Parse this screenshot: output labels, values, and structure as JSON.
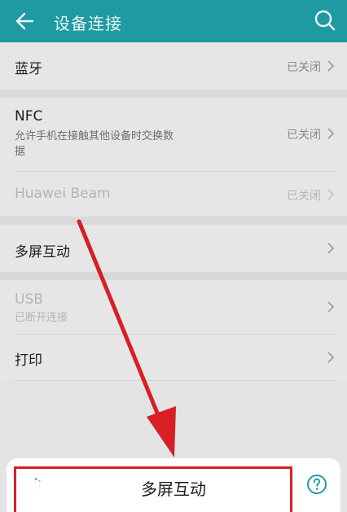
{
  "header": {
    "title": "设备连接",
    "back_icon": "arrow-left-icon",
    "search_icon": "search-icon"
  },
  "rows": {
    "bluetooth": {
      "label": "蓝牙",
      "status": "已关闭"
    },
    "nfc": {
      "label": "NFC",
      "sub_line1": "允许手机在接触其他设备时交换数",
      "sub_line2": "据",
      "status": "已关闭"
    },
    "huawei_beam": {
      "label": "Huawei Beam",
      "status": "已关闭"
    },
    "multiscreen": {
      "label": "多屏互动"
    },
    "usb": {
      "label": "USB",
      "sub": "已断开连接"
    },
    "print": {
      "label": "打印"
    }
  },
  "sheet": {
    "title": "多屏互动",
    "help_icon": "question-circle-icon",
    "spinner_icon": "loading-spinner-icon"
  },
  "colors": {
    "header_bg": "#1f9aa2",
    "accent": "#1f9aa2",
    "annotation_red": "#d71f25"
  }
}
